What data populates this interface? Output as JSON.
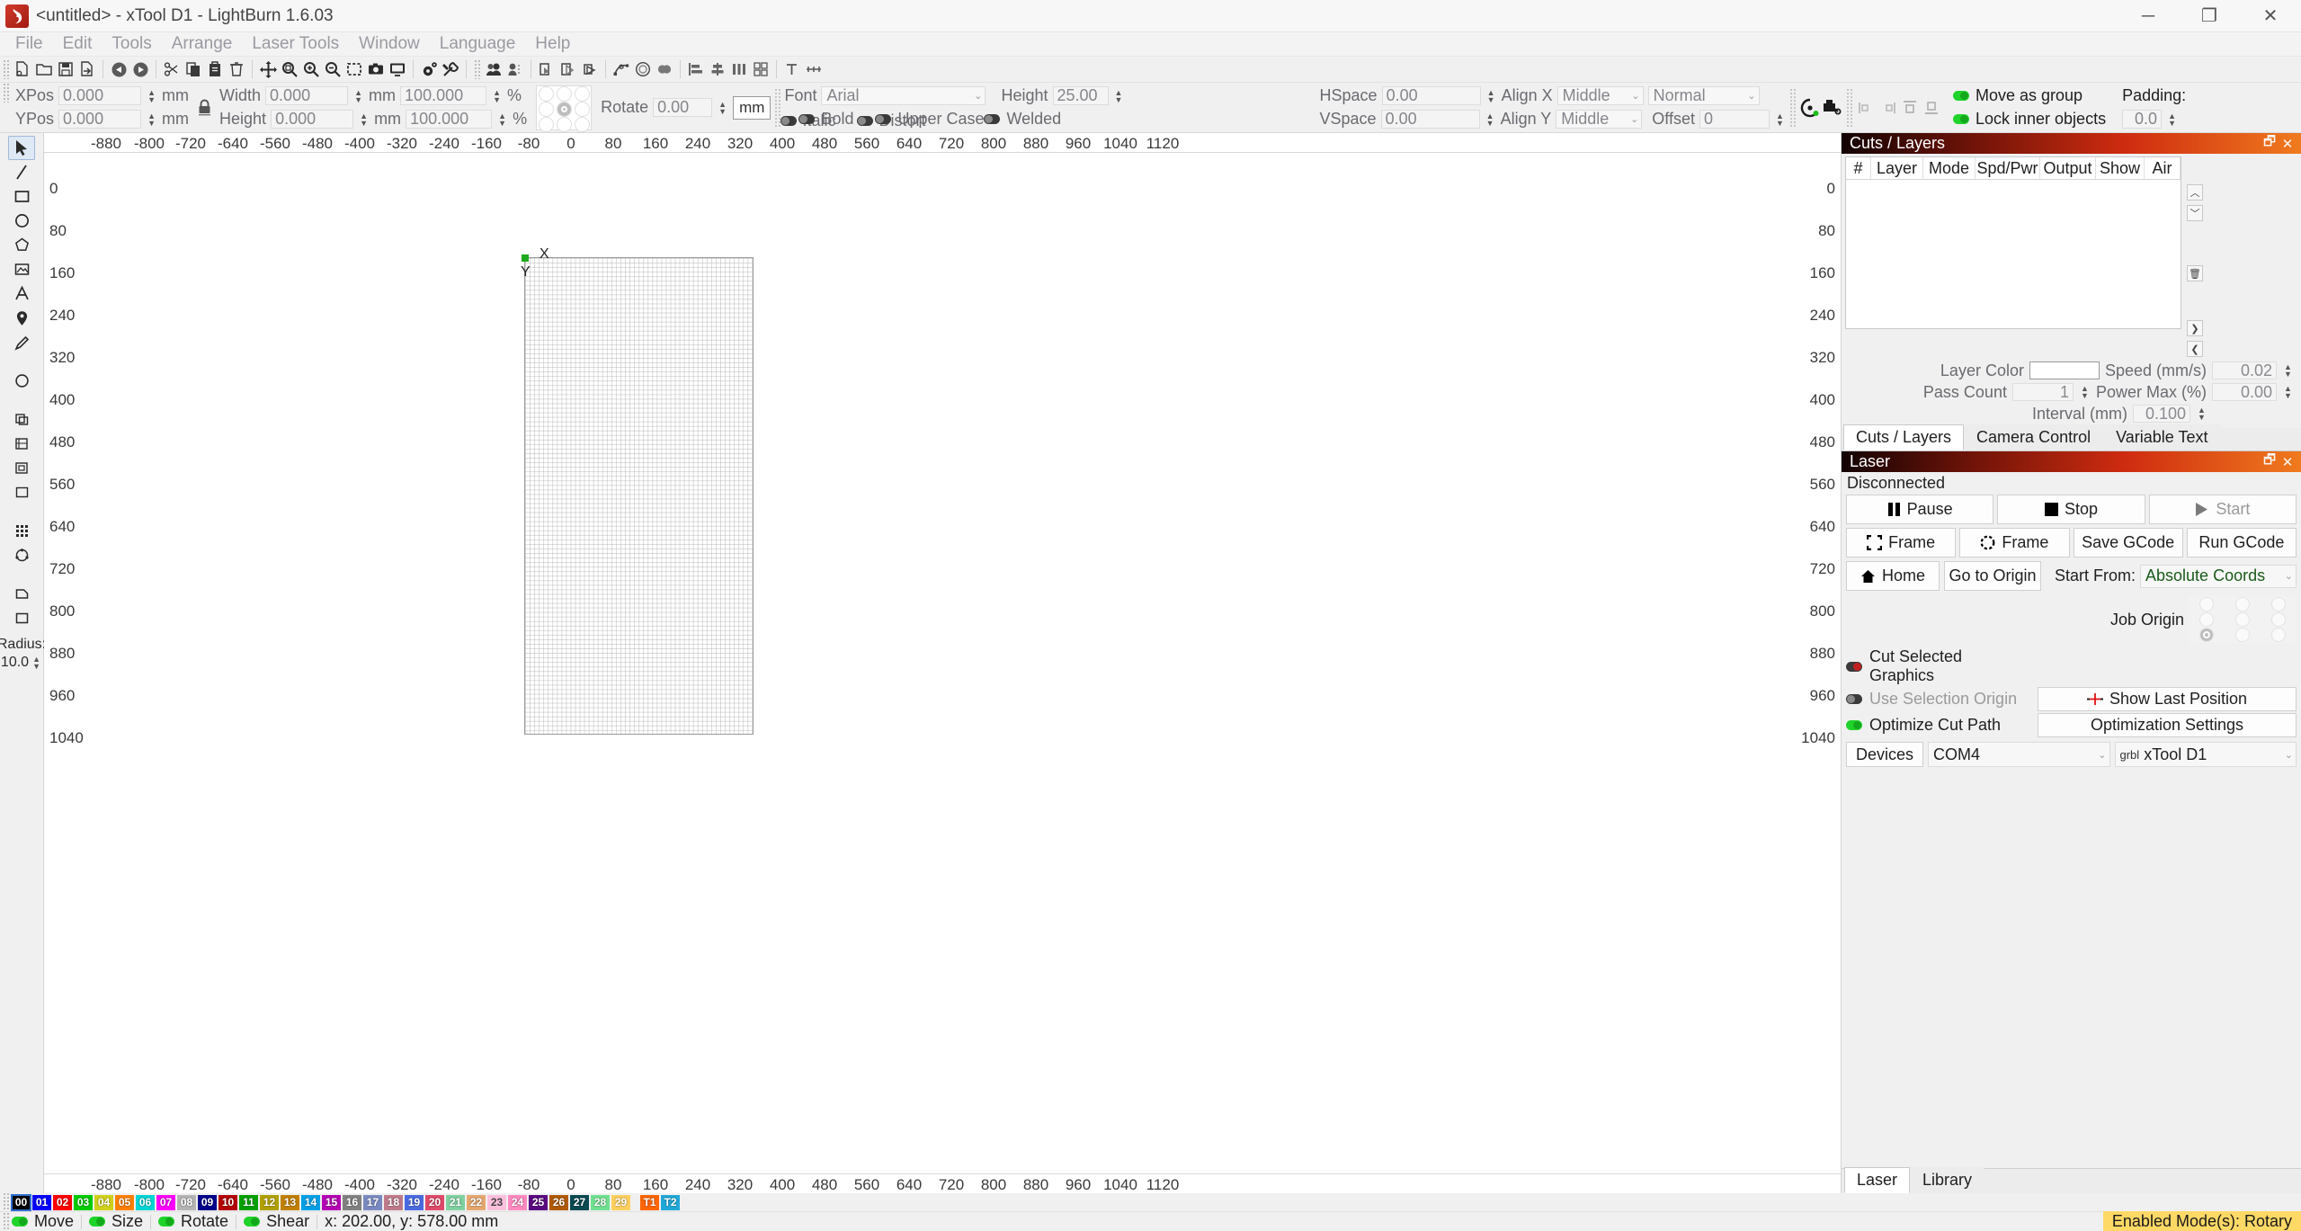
{
  "window": {
    "title": "<untitled> - xTool D1 - LightBurn 1.6.03",
    "minimize": "─",
    "maximize": "❐",
    "close": "✕"
  },
  "menubar": {
    "items": [
      "File",
      "Edit",
      "Tools",
      "Arrange",
      "Laser Tools",
      "Window",
      "Language",
      "Help"
    ]
  },
  "toolbar": {
    "groups": [
      [
        "new-file-icon",
        "open-folder-icon",
        "save-icon",
        "export-icon"
      ],
      [
        "undo-icon",
        "redo-icon"
      ],
      [
        "cut-scissors-icon",
        "copy-icon",
        "paste-icon",
        "delete-trash-icon"
      ],
      [
        "move-arrows-icon",
        "zoom-fit-icon",
        "zoom-in-icon",
        "zoom-out-icon",
        "zoom-selection-icon",
        "camera-icon",
        "monitor-preview-icon"
      ],
      [
        "settings-gear-icon",
        "device-wrench-icon"
      ],
      [
        "group-icon",
        "ungroup-icon"
      ],
      [
        "boolean-union-icon",
        "boolean-subtract-icon",
        "boolean-intersect-icon"
      ],
      [
        "node-edit-icon",
        "offset-icon",
        "weld-icon"
      ],
      [
        "align-left-icon",
        "align-center-icon",
        "distribute-icon",
        "grid-array-icon"
      ],
      [
        "text-tools-icon",
        "measure-icon"
      ]
    ]
  },
  "properties": {
    "xpos_label": "XPos",
    "xpos_value": "0.000",
    "ypos_label": "YPos",
    "ypos_value": "0.000",
    "unit_mm": "mm",
    "width_label": "Width",
    "width_value": "0.000",
    "height_label": "Height",
    "height_value": "0.000",
    "width_pct": "100.000",
    "height_pct": "100.000",
    "pct_symbol": "%",
    "lock_icon": "lock-closed-icon",
    "rotate_label": "Rotate",
    "rotate_value": "0.00",
    "rotate_unit": "mm"
  },
  "text_props": {
    "font_label": "Font",
    "font_value": "Arial",
    "bold_label": "Bold",
    "bold_on": false,
    "italic_label": "Italic",
    "italic_on": false,
    "upper_label": "Upper Case",
    "upper_on": false,
    "distort_label": "Distort",
    "distort_on": false,
    "height_label": "Height",
    "height_value": "25.00",
    "welded_label": "Welded",
    "welded_on": false,
    "hspace_label": "HSpace",
    "hspace_value": "0.00",
    "vspace_label": "VSpace",
    "vspace_value": "0.00",
    "alignx_label": "Align X",
    "alignx_value": "Middle",
    "aligny_label": "Align Y",
    "aligny_value": "Middle",
    "normal_value": "Normal",
    "offset_label": "Offset",
    "offset_value": "0"
  },
  "group_props": {
    "move_as_group_label": "Move as group",
    "move_as_group_on": true,
    "lock_inner_label": "Lock inner objects",
    "lock_inner_on": true,
    "padding_label": "Padding:",
    "padding_value": "0.0"
  },
  "tools": {
    "items": [
      {
        "name": "select-tool",
        "icon": "cursor-arrow-icon",
        "selected": true
      },
      {
        "name": "line-tool",
        "icon": "pen-line-icon",
        "selected": false
      },
      {
        "name": "rectangle-tool",
        "icon": "rectangle-icon",
        "selected": false
      },
      {
        "name": "ellipse-tool",
        "icon": "ellipse-icon",
        "selected": false
      },
      {
        "name": "polygon-tool",
        "icon": "polygon-icon",
        "selected": false
      },
      {
        "name": "trace-tool",
        "icon": "trace-bitmap-icon",
        "selected": false
      },
      {
        "name": "text-tool",
        "icon": "text-a-icon",
        "selected": false
      },
      {
        "name": "node-edit-tool",
        "icon": "node-pin-icon",
        "selected": false
      },
      {
        "name": "pencil-tool",
        "icon": "pencil-icon",
        "selected": false
      },
      {
        "name": "offset-tool",
        "icon": "offset-circle-icon",
        "selected": false
      },
      {
        "name": "copy-along-path-tool",
        "icon": "copy-path-icon",
        "selected": false
      },
      {
        "name": "virtual-array-tool",
        "icon": "virtual-array-icon",
        "selected": false
      },
      {
        "name": "weld-tool",
        "icon": "weld-shapes-icon",
        "selected": false
      },
      {
        "name": "boolean-tool",
        "icon": "boolean-shapes-icon",
        "selected": false
      },
      {
        "name": "grid-array-tool",
        "icon": "grid-dots-icon",
        "selected": false
      },
      {
        "name": "circular-array-tool",
        "icon": "circular-array-icon",
        "selected": false
      },
      {
        "name": "print-cut-tool",
        "icon": "print-cut-icon",
        "selected": false
      },
      {
        "name": "image-mask-tool",
        "icon": "image-mask-icon",
        "selected": false
      }
    ],
    "radius_label": "Radius:",
    "radius_value": "10.0"
  },
  "canvas": {
    "h_ticks": [
      "-880",
      "-800",
      "-720",
      "-640",
      "-560",
      "-480",
      "-400",
      "-320",
      "-240",
      "-160",
      "-80",
      "0",
      "80",
      "160",
      "240",
      "320",
      "400",
      "480",
      "560",
      "640",
      "720",
      "800",
      "880",
      "960",
      "1040",
      "1120"
    ],
    "v_ticks": [
      "0",
      "80",
      "160",
      "240",
      "320",
      "400",
      "480",
      "560",
      "640",
      "720",
      "800",
      "880",
      "960",
      "1040"
    ],
    "axis_x_label": "X",
    "axis_y_label": "Y"
  },
  "cuts_panel": {
    "title": "Cuts / Layers",
    "restore_icon": "restore-window-icon",
    "close_icon": "close-icon",
    "columns": [
      "#",
      "Layer",
      "Mode",
      "Spd/Pwr",
      "Output",
      "Show",
      "Air"
    ],
    "rows": [],
    "side_buttons": [
      "move-up-icon",
      "move-down-icon",
      "delete-icon",
      "move-right-icon",
      "move-left-icon"
    ],
    "layer_color_label": "Layer Color",
    "speed_label": "Speed (mm/s)",
    "speed_value": "0.02",
    "pass_count_label": "Pass Count",
    "pass_count_value": "1",
    "power_max_label": "Power Max (%)",
    "power_max_value": "0.00",
    "interval_label": "Interval (mm)",
    "interval_value": "0.100",
    "tabs": [
      "Cuts / Layers",
      "Camera Control",
      "Variable Text"
    ],
    "active_tab": "Cuts / Layers"
  },
  "laser_panel": {
    "title": "Laser",
    "restore_icon": "restore-window-icon",
    "close_icon": "close-icon",
    "status": "Disconnected",
    "pause_label": "Pause",
    "stop_label": "Stop",
    "start_label": "Start",
    "frame_square_label": "Frame",
    "frame_round_label": "Frame",
    "save_gcode_label": "Save GCode",
    "run_gcode_label": "Run GCode",
    "home_label": "Home",
    "go_to_origin_label": "Go to Origin",
    "start_from_label": "Start From:",
    "start_from_value": "Absolute Coords",
    "job_origin_label": "Job Origin",
    "cut_selected_label": "Cut Selected Graphics",
    "cut_selected_on": false,
    "use_selection_origin_label": "Use Selection Origin",
    "use_selection_origin_on": false,
    "optimize_cut_label": "Optimize Cut Path",
    "optimize_cut_on": true,
    "show_last_position_label": "Show Last Position",
    "optimization_settings_label": "Optimization Settings",
    "devices_label": "Devices",
    "port_value": "COM4",
    "device_value": "xTool D1",
    "device_prefix": "grbl",
    "tabs": [
      "Laser",
      "Library"
    ],
    "active_tab": "Laser"
  },
  "palette": {
    "swatches": [
      {
        "n": "00",
        "c": "#000000"
      },
      {
        "n": "01",
        "c": "#0000ff"
      },
      {
        "n": "02",
        "c": "#ff0000"
      },
      {
        "n": "03",
        "c": "#00cc00"
      },
      {
        "n": "04",
        "c": "#d1d11b"
      },
      {
        "n": "05",
        "c": "#ff8000"
      },
      {
        "n": "06",
        "c": "#00d5d5"
      },
      {
        "n": "07",
        "c": "#ff00ff"
      },
      {
        "n": "08",
        "c": "#b4b4b4"
      },
      {
        "n": "09",
        "c": "#00008b"
      },
      {
        "n": "10",
        "c": "#b40000"
      },
      {
        "n": "11",
        "c": "#00a000"
      },
      {
        "n": "12",
        "c": "#b0a000"
      },
      {
        "n": "13",
        "c": "#c08000"
      },
      {
        "n": "14",
        "c": "#00a0e6"
      },
      {
        "n": "15",
        "c": "#b400b4"
      },
      {
        "n": "16",
        "c": "#808080"
      },
      {
        "n": "17",
        "c": "#7a8ac0"
      },
      {
        "n": "18",
        "c": "#c07a8a"
      },
      {
        "n": "19",
        "c": "#4a6ae0"
      },
      {
        "n": "20",
        "c": "#e04a6a"
      },
      {
        "n": "21",
        "c": "#80d0a0"
      },
      {
        "n": "22",
        "c": "#e6a870"
      },
      {
        "n": "23",
        "c": "#ffc0dd"
      },
      {
        "n": "24",
        "c": "#ff8ac0"
      },
      {
        "n": "25",
        "c": "#5a0a80"
      },
      {
        "n": "26",
        "c": "#b05a0a"
      },
      {
        "n": "27",
        "c": "#0a4a50"
      },
      {
        "n": "28",
        "c": "#70e090"
      },
      {
        "n": "29",
        "c": "#ffd060"
      }
    ],
    "tool_swatches": [
      {
        "n": "T1",
        "c": "#ff6600"
      },
      {
        "n": "T2",
        "c": "#22a8d8"
      }
    ],
    "selected": "00"
  },
  "statusbar": {
    "move_label": "Move",
    "move_on": true,
    "size_label": "Size",
    "size_on": true,
    "rotate_label": "Rotate",
    "rotate_on": true,
    "shear_label": "Shear",
    "shear_on": true,
    "coords": "x: 202.00, y: 578.00 mm",
    "mode_badge": "Enabled Mode(s): Rotary"
  }
}
